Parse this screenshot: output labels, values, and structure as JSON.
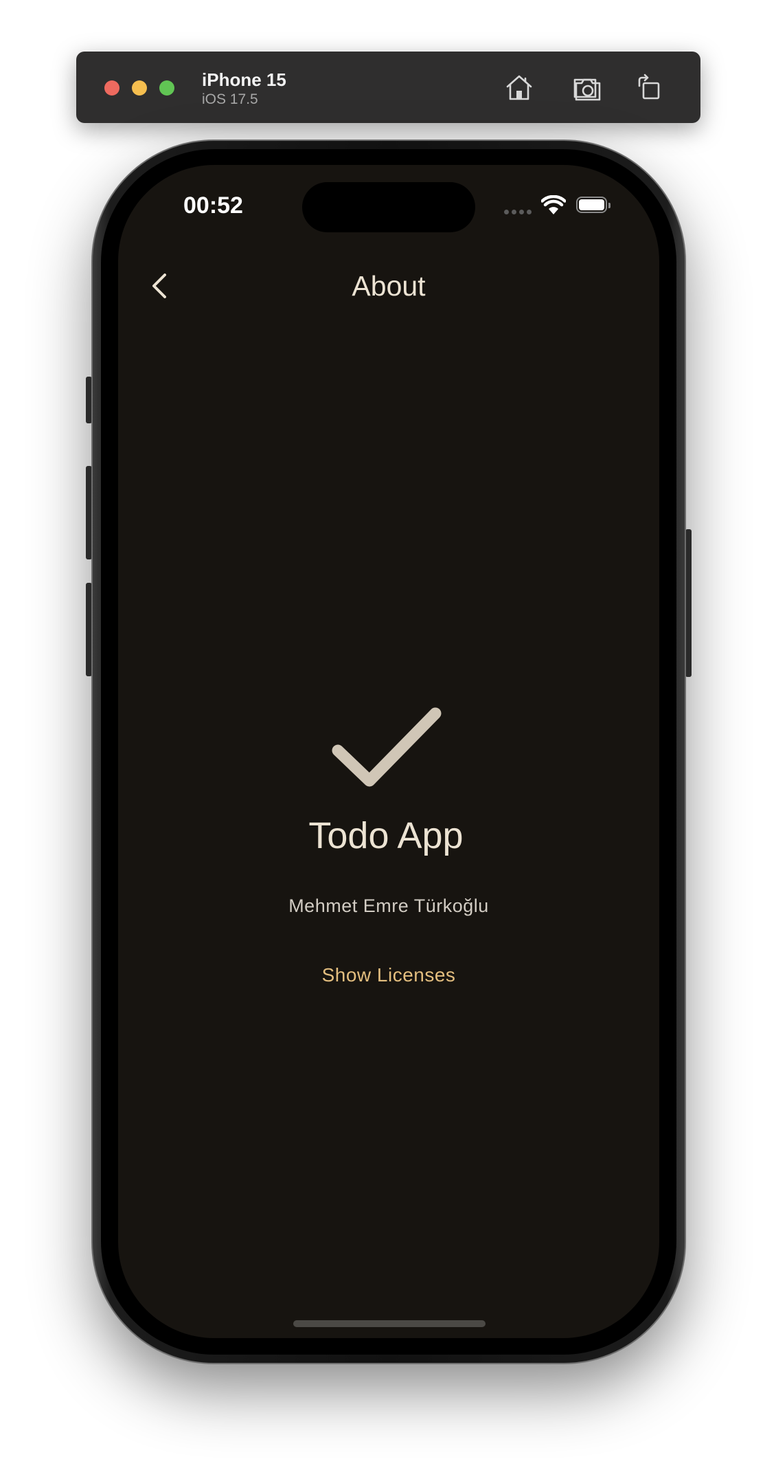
{
  "simulator": {
    "device_name": "iPhone 15",
    "os_version": "iOS 17.5",
    "toolbar_icons": [
      "home-icon",
      "screenshot-icon",
      "rotate-icon"
    ]
  },
  "status_bar": {
    "time": "00:52",
    "icons": [
      "cellular-signal-icon",
      "wifi-icon",
      "battery-icon"
    ]
  },
  "nav": {
    "back_icon": "chevron-left-icon",
    "title": "About"
  },
  "about": {
    "logo_icon": "checkmark-icon",
    "app_name": "Todo App",
    "author": "Mehmet Emre Türkoğlu",
    "licenses_label": "Show Licenses"
  },
  "colors": {
    "background": "#171410",
    "title_text": "#ece3d3",
    "checkmark": "#d0c6b6",
    "accent": "#e3be7f"
  }
}
